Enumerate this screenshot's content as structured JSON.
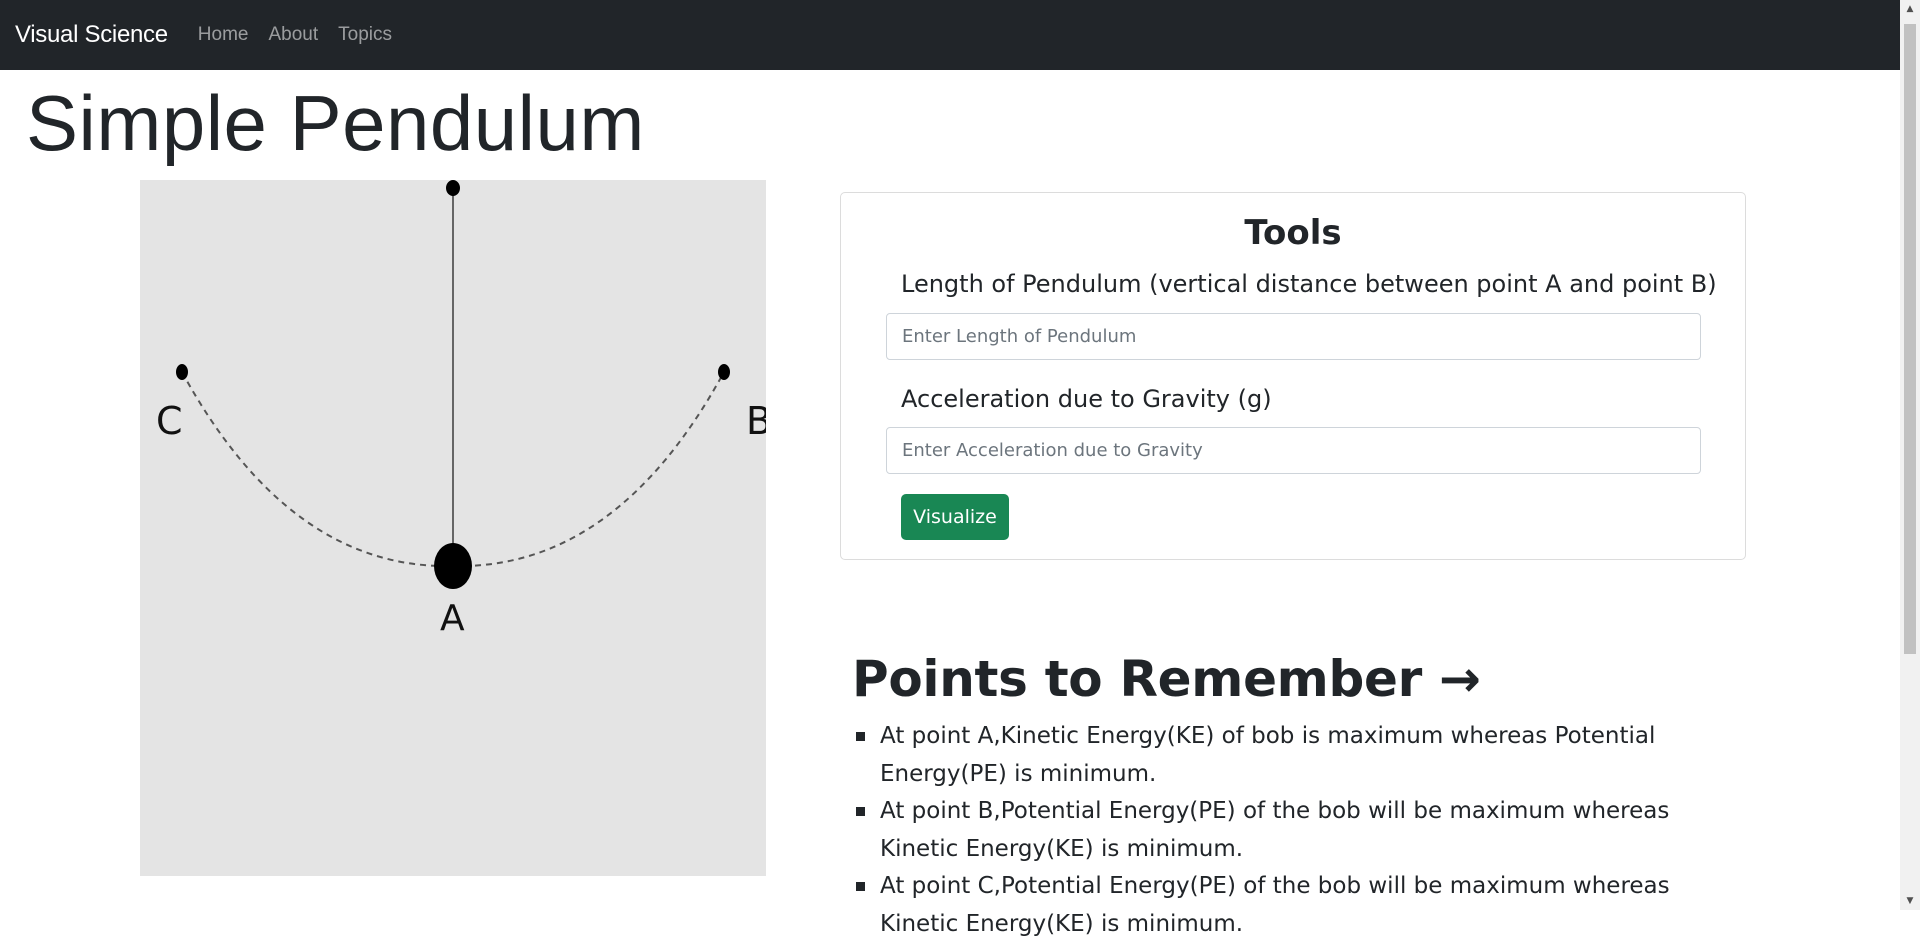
{
  "navbar": {
    "brand": "Visual Science",
    "links": [
      "Home",
      "About",
      "Topics"
    ]
  },
  "page": {
    "title": "Simple Pendulum"
  },
  "diagram": {
    "point_labels": {
      "a": "A",
      "b": "B",
      "c": "C"
    }
  },
  "tools": {
    "title": "Tools",
    "length_label": "Length of Pendulum (vertical distance between point A and point B)",
    "length_placeholder": "Enter Length of Pendulum",
    "length_value": "",
    "gravity_label": "Acceleration due to Gravity (g)",
    "gravity_placeholder": "Enter Acceleration due to Gravity",
    "gravity_value": "",
    "button_label": "Visualize"
  },
  "points": {
    "title": "Points to Remember →",
    "items": [
      "At point A,Kinetic Energy(KE) of bob is maximum whereas Potential Energy(PE) is minimum.",
      "At point B,Potential Energy(PE) of the bob will be maximum whereas Kinetic Energy(KE) is minimum.",
      "At point C,Potential Energy(PE) of the bob will be maximum whereas Kinetic Energy(KE) is minimum."
    ]
  },
  "colors": {
    "navbar": "#212529",
    "button": "#198754",
    "diagram_bg": "#e4e4e4"
  }
}
